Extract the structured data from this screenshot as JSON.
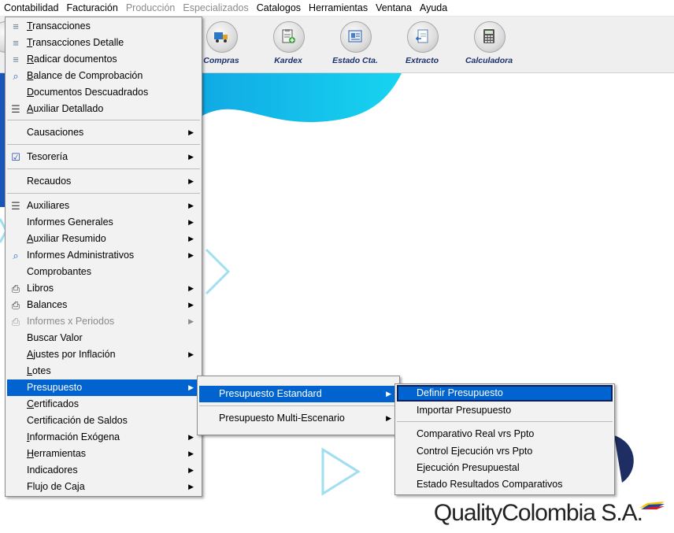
{
  "menubar": {
    "items": [
      {
        "label": "Contabilidad",
        "disabled": false
      },
      {
        "label": "Facturación",
        "disabled": false
      },
      {
        "label": "Producción",
        "disabled": true
      },
      {
        "label": "Especializados",
        "disabled": true
      },
      {
        "label": "Catalogos",
        "disabled": false
      },
      {
        "label": "Herramientas",
        "disabled": false
      },
      {
        "label": "Ventana",
        "disabled": false
      },
      {
        "label": "Ayuda",
        "disabled": false
      }
    ]
  },
  "toolbar": {
    "buttons": [
      {
        "label": "Compras",
        "icon": "truck-icon"
      },
      {
        "label": "Kardex",
        "icon": "clipboard-add-icon"
      },
      {
        "label": "Estado Cta.",
        "icon": "id-card-icon"
      },
      {
        "label": "Extracto",
        "icon": "document-back-icon"
      },
      {
        "label": "Calculadora",
        "icon": "calculator-icon"
      }
    ]
  },
  "menu_contabilidad": {
    "items": [
      {
        "label": "Transacciones",
        "icon": "transaction-icon"
      },
      {
        "label": "Transacciones Detalle",
        "icon": "transaction-icon"
      },
      {
        "label": "Radicar documentos",
        "icon": "transaction-icon"
      },
      {
        "label": "Balance de Comprobación",
        "icon": "magnifier-icon"
      },
      {
        "label": "Documentos Descuadrados",
        "icon": ""
      },
      {
        "label": "Auxiliar Detallado",
        "icon": "ledger-icon"
      },
      {
        "label": "Causaciones",
        "icon": "",
        "submenu": true
      },
      {
        "label": "Tesorería",
        "icon": "treasury-icon",
        "submenu": true
      },
      {
        "label": "Recaudos",
        "icon": "",
        "submenu": true
      },
      {
        "label": "Auxiliares",
        "icon": "ledger-icon",
        "submenu": true
      },
      {
        "label": "Informes Generales",
        "icon": "",
        "submenu": true
      },
      {
        "label": "Auxiliar Resumido",
        "icon": "",
        "submenu": true
      },
      {
        "label": "Informes Administrativos",
        "icon": "magnifier-icon",
        "submenu": true
      },
      {
        "label": "Comprobantes",
        "icon": ""
      },
      {
        "label": "Libros",
        "icon": "printer-icon",
        "submenu": true
      },
      {
        "label": "Balances",
        "icon": "printer-icon",
        "submenu": true
      },
      {
        "label": "Informes x Periodos",
        "icon": "printer-icon",
        "submenu": true,
        "disabled": true
      },
      {
        "label": "Buscar Valor",
        "icon": ""
      },
      {
        "label": "Ajustes por Inflación",
        "icon": "",
        "submenu": true
      },
      {
        "label": "Lotes",
        "icon": ""
      },
      {
        "label": "Presupuesto",
        "icon": "",
        "submenu": true,
        "selected": true
      },
      {
        "label": "Certificados",
        "icon": ""
      },
      {
        "label": "Certificación de Saldos",
        "icon": ""
      },
      {
        "label": "Información Exógena",
        "icon": "",
        "submenu": true
      },
      {
        "label": "Herramientas",
        "icon": "",
        "submenu": true
      },
      {
        "label": "Indicadores",
        "icon": "",
        "submenu": true
      },
      {
        "label": "Flujo de Caja",
        "icon": "",
        "submenu": true
      }
    ]
  },
  "menu_presupuesto": {
    "items": [
      {
        "label": "Presupuesto  Estandard",
        "submenu": true,
        "selected": true
      },
      {
        "label": "Presupuesto Multi-Escenario",
        "submenu": true
      }
    ]
  },
  "menu_estandard": {
    "items": [
      {
        "label": "Definir Presupuesto",
        "selected": true
      },
      {
        "label": "Importar Presupuesto"
      },
      {
        "label": "Comparativo  Real vrs Ppto"
      },
      {
        "label": "Control Ejecución vrs Ppto"
      },
      {
        "label": "Ejecución Presupuestal"
      },
      {
        "label": "Estado Resultados Comparativos"
      }
    ]
  },
  "brand": {
    "text": "QualityColombia S.A."
  },
  "colors": {
    "accent": "#0063cf",
    "wave": "#15c8ee",
    "label": "#1a2f6b"
  }
}
